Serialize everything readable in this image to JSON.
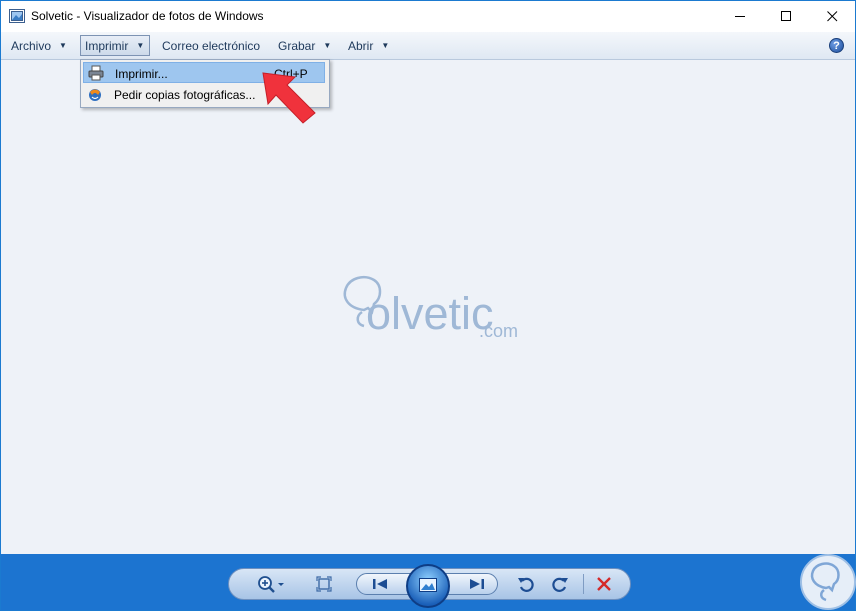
{
  "window": {
    "title": "Solvetic - Visualizador de fotos de Windows",
    "controls": {
      "minimize": "—",
      "maximize": "☐",
      "close": "✕"
    }
  },
  "menu": {
    "archivo": "Archivo",
    "imprimir": "Imprimir",
    "correo": "Correo electrónico",
    "grabar": "Grabar",
    "abrir": "Abrir",
    "help": "?"
  },
  "dropdown": {
    "items": [
      {
        "label": "Imprimir...",
        "shortcut": "Ctrl+P",
        "icon": "printer-icon"
      },
      {
        "label": "Pedir copias fotográficas...",
        "shortcut": "",
        "icon": "order-prints-icon"
      }
    ]
  },
  "image": {
    "logo_main": "olvetic",
    "logo_suffix": ".com"
  },
  "toolbar": {
    "tools": [
      "zoom-icon",
      "fit-window-icon",
      "previous-icon",
      "slideshow-icon",
      "next-icon",
      "rotate-left-icon",
      "rotate-right-icon",
      "delete-icon"
    ]
  },
  "colors": {
    "accent": "#1c74d0",
    "highlight": "#9ec6ef",
    "arrow": "#f0323c",
    "delete": "#d42a2a"
  }
}
